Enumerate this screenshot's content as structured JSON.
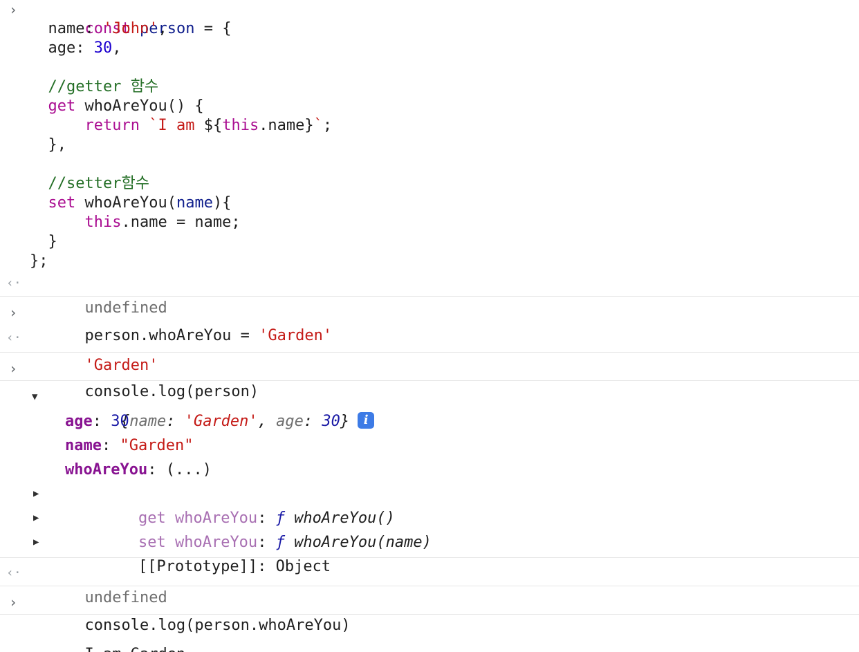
{
  "console": {
    "entry1": {
      "lines": [
        {
          "parts": [
            "const",
            " ",
            "person",
            " = {"
          ]
        },
        {
          "parts": [
            "  name: ",
            "'John'",
            ","
          ]
        },
        {
          "parts": [
            "  age: ",
            "30",
            ","
          ]
        },
        {
          "parts": [
            ""
          ]
        },
        {
          "parts": [
            "  //getter 함수"
          ]
        },
        {
          "parts": [
            "  ",
            "get",
            " whoAreYou() {"
          ]
        },
        {
          "parts": [
            "      ",
            "return",
            " ",
            "`I am ",
            "${",
            "this",
            ".name",
            "}",
            "`",
            ";"
          ]
        },
        {
          "parts": [
            "  },"
          ]
        },
        {
          "parts": [
            ""
          ]
        },
        {
          "parts": [
            "  //setter함수"
          ]
        },
        {
          "parts": [
            "  ",
            "set",
            " whoAreYou(",
            "name",
            "){"
          ]
        },
        {
          "parts": [
            "      ",
            "this",
            ".name = name;"
          ]
        },
        {
          "parts": [
            "  }"
          ]
        },
        {
          "parts": [
            "};"
          ]
        }
      ],
      "result": "undefined"
    },
    "entry2": {
      "input_prefix": "person.whoAreYou = ",
      "input_string": "'Garden'",
      "result": "'Garden'"
    },
    "entry3": {
      "input": "console.log(person)",
      "object_preview": {
        "open": "{",
        "k1": "name",
        "sep": ": ",
        "v1": "'Garden'",
        "comma": ", ",
        "k2": "age",
        "v2": "30",
        "close": "}",
        "info": "i"
      },
      "props": [
        {
          "key": "age",
          "value": "30"
        },
        {
          "key": "name",
          "value": "\"Garden\""
        },
        {
          "key": "whoAreYou",
          "value": "(...)"
        }
      ],
      "accessors": [
        {
          "prefix": "get",
          "name": "whoAreYou",
          "f": "ƒ",
          "sig": "whoAreYou()"
        },
        {
          "prefix": "set",
          "name": "whoAreYou",
          "f": "ƒ",
          "sig": "whoAreYou(name)"
        }
      ],
      "prototype": {
        "key": "[[Prototype]]",
        "value": "Object"
      },
      "result": "undefined"
    },
    "entry4": {
      "input": "console.log(person.whoAreYou)",
      "output": "I am Garden"
    }
  },
  "icons": {
    "input_chevron": "›",
    "result_arrow": "‹·",
    "tri_down": "▼",
    "tri_right": "▶"
  }
}
